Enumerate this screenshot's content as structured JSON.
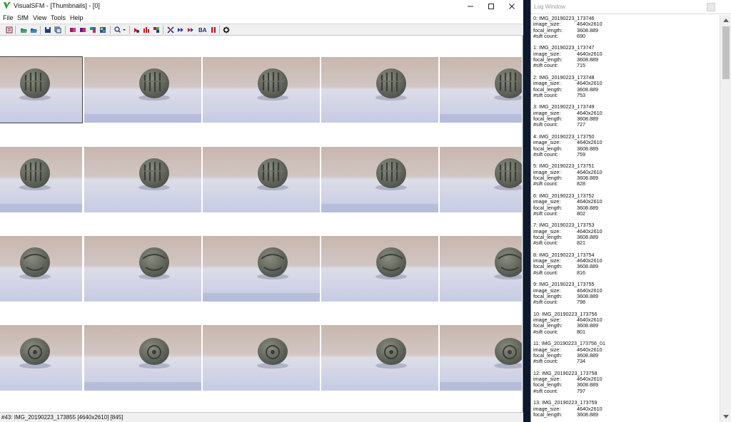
{
  "app": {
    "title": "VisualSFM - [Thumbnails] - [0]",
    "menu": [
      "File",
      "SfM",
      "View",
      "Tools",
      "Help"
    ],
    "toolbar_text_button": "BA",
    "status": "#43: IMG_20190223_173855 [4640x2610] [845]"
  },
  "thumbnails": {
    "rows": 4,
    "cols": 5,
    "selected_index": 0
  },
  "icons": [
    "visualsfm-logo-icon",
    "minimize-icon",
    "maximize-icon",
    "close-icon",
    "gear-icon",
    "scroll-up-icon",
    "scroll-down-icon"
  ],
  "log": {
    "title": "Log Window",
    "labels": {
      "size": "image_size:",
      "focal": "focal_length:",
      "sift": "#sift count:"
    },
    "entries": [
      {
        "header": "0: IMG_20190223_173746",
        "size": "4640x2610",
        "focal": "3608.889",
        "sift": "690"
      },
      {
        "header": "1: IMG_20190223_173747",
        "size": "4640x2610",
        "focal": "3608.889",
        "sift": "715"
      },
      {
        "header": "2: IMG_20190223_173748",
        "size": "4640x2610",
        "focal": "3608.889",
        "sift": "753"
      },
      {
        "header": "3: IMG_20190223_173749",
        "size": "4640x2610",
        "focal": "3608.889",
        "sift": "727"
      },
      {
        "header": "4: IMG_20190223_173750",
        "size": "4640x2610",
        "focal": "3608.889",
        "sift": "759"
      },
      {
        "header": "5: IMG_20190223_173751",
        "size": "4640x2610",
        "focal": "3608.889",
        "sift": "828"
      },
      {
        "header": "6: IMG_20190223_173752",
        "size": "4640x2610",
        "focal": "3608.889",
        "sift": "802"
      },
      {
        "header": "7: IMG_20190223_173753",
        "size": "4640x2610",
        "focal": "3608.889",
        "sift": "821"
      },
      {
        "header": "8: IMG_20190223_173754",
        "size": "4640x2610",
        "focal": "3608.889",
        "sift": "816"
      },
      {
        "header": "9: IMG_20190223_173755",
        "size": "4640x2610",
        "focal": "3608.889",
        "sift": "798"
      },
      {
        "header": "10: IMG_20190223_173756",
        "size": "4640x2610",
        "focal": "3608.889",
        "sift": "801"
      },
      {
        "header": "11: IMG_20190223_173756_01",
        "size": "4640x2610",
        "focal": "3608.889",
        "sift": "734"
      },
      {
        "header": "12: IMG_20190223_173758",
        "size": "4640x2610",
        "focal": "3608.889",
        "sift": "797"
      },
      {
        "header": "13: IMG_20190223_173759",
        "size": "4640x2610",
        "focal": "3608.889",
        "sift": ""
      }
    ]
  }
}
